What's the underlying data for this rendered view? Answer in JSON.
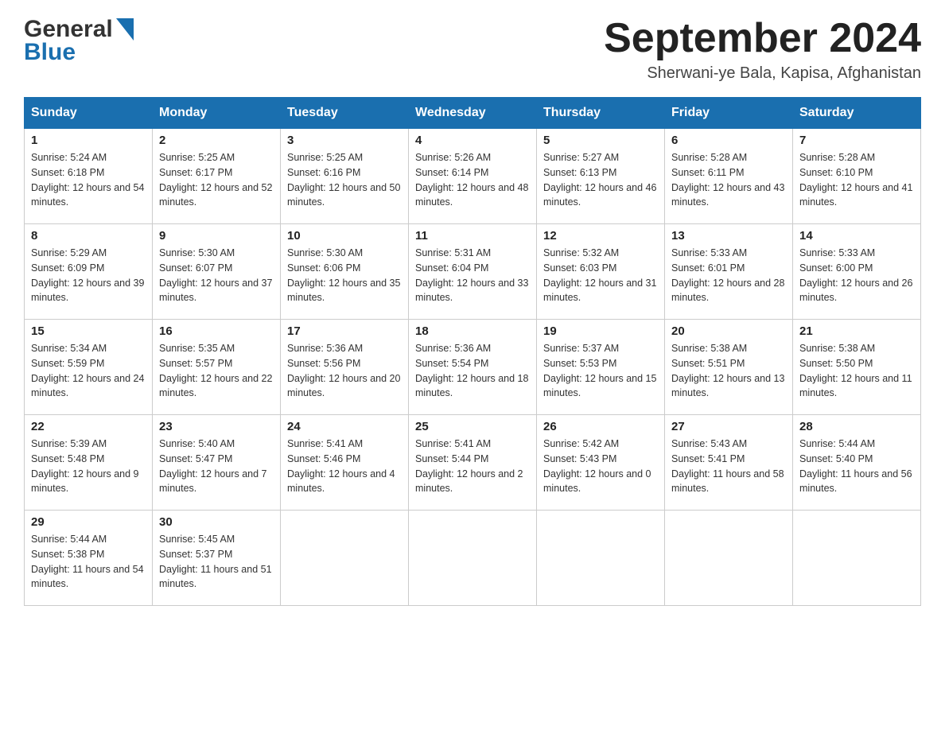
{
  "header": {
    "logo_general": "General",
    "logo_blue": "Blue",
    "month_title": "September 2024",
    "location": "Sherwani-ye Bala, Kapisa, Afghanistan"
  },
  "days_of_week": [
    "Sunday",
    "Monday",
    "Tuesday",
    "Wednesday",
    "Thursday",
    "Friday",
    "Saturday"
  ],
  "weeks": [
    [
      {
        "day": "1",
        "sunrise": "5:24 AM",
        "sunset": "6:18 PM",
        "daylight": "12 hours and 54 minutes."
      },
      {
        "day": "2",
        "sunrise": "5:25 AM",
        "sunset": "6:17 PM",
        "daylight": "12 hours and 52 minutes."
      },
      {
        "day": "3",
        "sunrise": "5:25 AM",
        "sunset": "6:16 PM",
        "daylight": "12 hours and 50 minutes."
      },
      {
        "day": "4",
        "sunrise": "5:26 AM",
        "sunset": "6:14 PM",
        "daylight": "12 hours and 48 minutes."
      },
      {
        "day": "5",
        "sunrise": "5:27 AM",
        "sunset": "6:13 PM",
        "daylight": "12 hours and 46 minutes."
      },
      {
        "day": "6",
        "sunrise": "5:28 AM",
        "sunset": "6:11 PM",
        "daylight": "12 hours and 43 minutes."
      },
      {
        "day": "7",
        "sunrise": "5:28 AM",
        "sunset": "6:10 PM",
        "daylight": "12 hours and 41 minutes."
      }
    ],
    [
      {
        "day": "8",
        "sunrise": "5:29 AM",
        "sunset": "6:09 PM",
        "daylight": "12 hours and 39 minutes."
      },
      {
        "day": "9",
        "sunrise": "5:30 AM",
        "sunset": "6:07 PM",
        "daylight": "12 hours and 37 minutes."
      },
      {
        "day": "10",
        "sunrise": "5:30 AM",
        "sunset": "6:06 PM",
        "daylight": "12 hours and 35 minutes."
      },
      {
        "day": "11",
        "sunrise": "5:31 AM",
        "sunset": "6:04 PM",
        "daylight": "12 hours and 33 minutes."
      },
      {
        "day": "12",
        "sunrise": "5:32 AM",
        "sunset": "6:03 PM",
        "daylight": "12 hours and 31 minutes."
      },
      {
        "day": "13",
        "sunrise": "5:33 AM",
        "sunset": "6:01 PM",
        "daylight": "12 hours and 28 minutes."
      },
      {
        "day": "14",
        "sunrise": "5:33 AM",
        "sunset": "6:00 PM",
        "daylight": "12 hours and 26 minutes."
      }
    ],
    [
      {
        "day": "15",
        "sunrise": "5:34 AM",
        "sunset": "5:59 PM",
        "daylight": "12 hours and 24 minutes."
      },
      {
        "day": "16",
        "sunrise": "5:35 AM",
        "sunset": "5:57 PM",
        "daylight": "12 hours and 22 minutes."
      },
      {
        "day": "17",
        "sunrise": "5:36 AM",
        "sunset": "5:56 PM",
        "daylight": "12 hours and 20 minutes."
      },
      {
        "day": "18",
        "sunrise": "5:36 AM",
        "sunset": "5:54 PM",
        "daylight": "12 hours and 18 minutes."
      },
      {
        "day": "19",
        "sunrise": "5:37 AM",
        "sunset": "5:53 PM",
        "daylight": "12 hours and 15 minutes."
      },
      {
        "day": "20",
        "sunrise": "5:38 AM",
        "sunset": "5:51 PM",
        "daylight": "12 hours and 13 minutes."
      },
      {
        "day": "21",
        "sunrise": "5:38 AM",
        "sunset": "5:50 PM",
        "daylight": "12 hours and 11 minutes."
      }
    ],
    [
      {
        "day": "22",
        "sunrise": "5:39 AM",
        "sunset": "5:48 PM",
        "daylight": "12 hours and 9 minutes."
      },
      {
        "day": "23",
        "sunrise": "5:40 AM",
        "sunset": "5:47 PM",
        "daylight": "12 hours and 7 minutes."
      },
      {
        "day": "24",
        "sunrise": "5:41 AM",
        "sunset": "5:46 PM",
        "daylight": "12 hours and 4 minutes."
      },
      {
        "day": "25",
        "sunrise": "5:41 AM",
        "sunset": "5:44 PM",
        "daylight": "12 hours and 2 minutes."
      },
      {
        "day": "26",
        "sunrise": "5:42 AM",
        "sunset": "5:43 PM",
        "daylight": "12 hours and 0 minutes."
      },
      {
        "day": "27",
        "sunrise": "5:43 AM",
        "sunset": "5:41 PM",
        "daylight": "11 hours and 58 minutes."
      },
      {
        "day": "28",
        "sunrise": "5:44 AM",
        "sunset": "5:40 PM",
        "daylight": "11 hours and 56 minutes."
      }
    ],
    [
      {
        "day": "29",
        "sunrise": "5:44 AM",
        "sunset": "5:38 PM",
        "daylight": "11 hours and 54 minutes."
      },
      {
        "day": "30",
        "sunrise": "5:45 AM",
        "sunset": "5:37 PM",
        "daylight": "11 hours and 51 minutes."
      },
      null,
      null,
      null,
      null,
      null
    ]
  ]
}
